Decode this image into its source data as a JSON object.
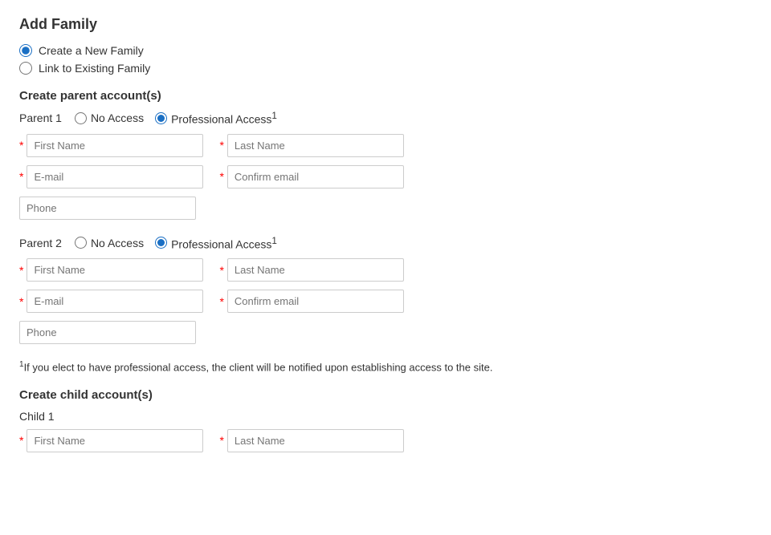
{
  "page": {
    "title": "Add Family"
  },
  "family_options": {
    "option1": "Create a New Family",
    "option2": "Link to Existing Family"
  },
  "parent_section": {
    "title": "Create parent account(s)"
  },
  "parent1": {
    "label": "Parent 1",
    "access_no": "No Access",
    "access_professional": "Professional Access",
    "access_superscript": "1",
    "fields": {
      "first_name": "First Name",
      "last_name": "Last Name",
      "email": "E-mail",
      "confirm_email": "Confirm email",
      "phone": "Phone"
    }
  },
  "parent2": {
    "label": "Parent 2",
    "access_no": "No Access",
    "access_professional": "Professional Access",
    "access_superscript": "1",
    "fields": {
      "first_name": "First Name",
      "last_name": "Last Name",
      "email": "E-mail",
      "confirm_email": "Confirm email",
      "phone": "Phone"
    }
  },
  "footnote": {
    "superscript": "1",
    "text": "If you elect to have professional access, the client will be notified upon establishing access to the site."
  },
  "child_section": {
    "title": "Create child account(s)",
    "child_label": "Child 1",
    "fields": {
      "first_name": "First Name",
      "last_name": "Last Name"
    }
  }
}
